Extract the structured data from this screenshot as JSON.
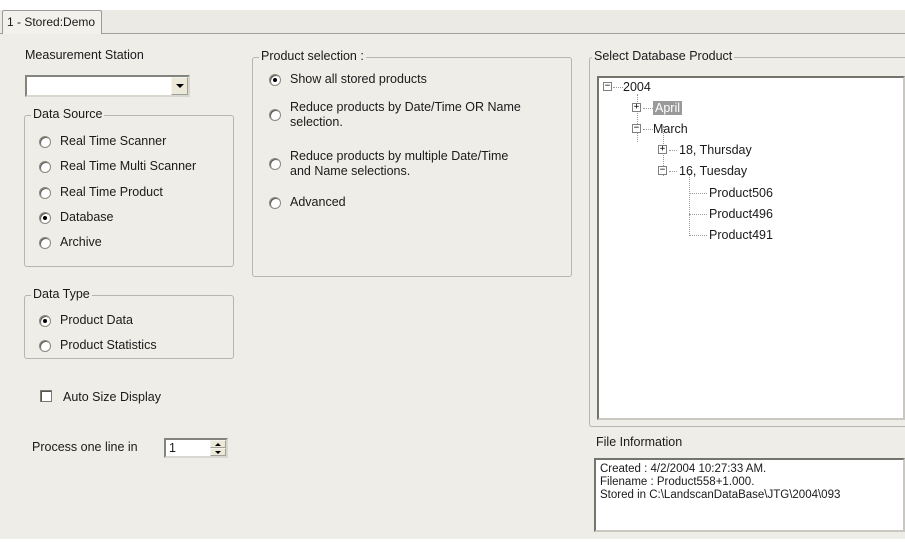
{
  "tab": {
    "label": "1 - Stored:Demo"
  },
  "measurement_station": {
    "label": "Measurement Station",
    "value": ""
  },
  "data_source": {
    "title": "Data Source",
    "options": [
      {
        "label": "Real Time Scanner",
        "selected": false
      },
      {
        "label": "Real Time Multi Scanner",
        "selected": false
      },
      {
        "label": "Real Time Product",
        "selected": false
      },
      {
        "label": "Database",
        "selected": true
      },
      {
        "label": "Archive",
        "selected": false
      }
    ]
  },
  "data_type": {
    "title": "Data Type",
    "options": [
      {
        "label": "Product Data",
        "selected": true
      },
      {
        "label": "Product Statistics",
        "selected": false
      }
    ]
  },
  "auto_size": {
    "label": "Auto Size Display",
    "checked": false
  },
  "process_line": {
    "label": "Process one line in",
    "value": "1"
  },
  "product_selection": {
    "title": "Product selection :",
    "options": [
      {
        "label": "Show all stored products",
        "selected": true
      },
      {
        "label_line1": "Reduce products by Date/Time OR Name",
        "label_line2": "selection.",
        "selected": false
      },
      {
        "label_line1": "Reduce products by multiple Date/Time",
        "label_line2": "and Name selections.",
        "selected": false
      },
      {
        "label": "Advanced",
        "selected": false
      }
    ]
  },
  "database_product": {
    "title": "Select Database Product",
    "tree": {
      "year": "2004",
      "april": "April",
      "march": "March",
      "day18": "18, Thursday",
      "day16": "16, Tuesday",
      "products": [
        "Product506",
        "Product496",
        "Product491"
      ]
    }
  },
  "file_information": {
    "title": "File Information",
    "lines": [
      "Created : 4/2/2004 10:27:33 AM.",
      "Filename : Product558+1.000.",
      "Stored in C:\\LandscanDataBase\\JTG\\2004\\093"
    ]
  }
}
